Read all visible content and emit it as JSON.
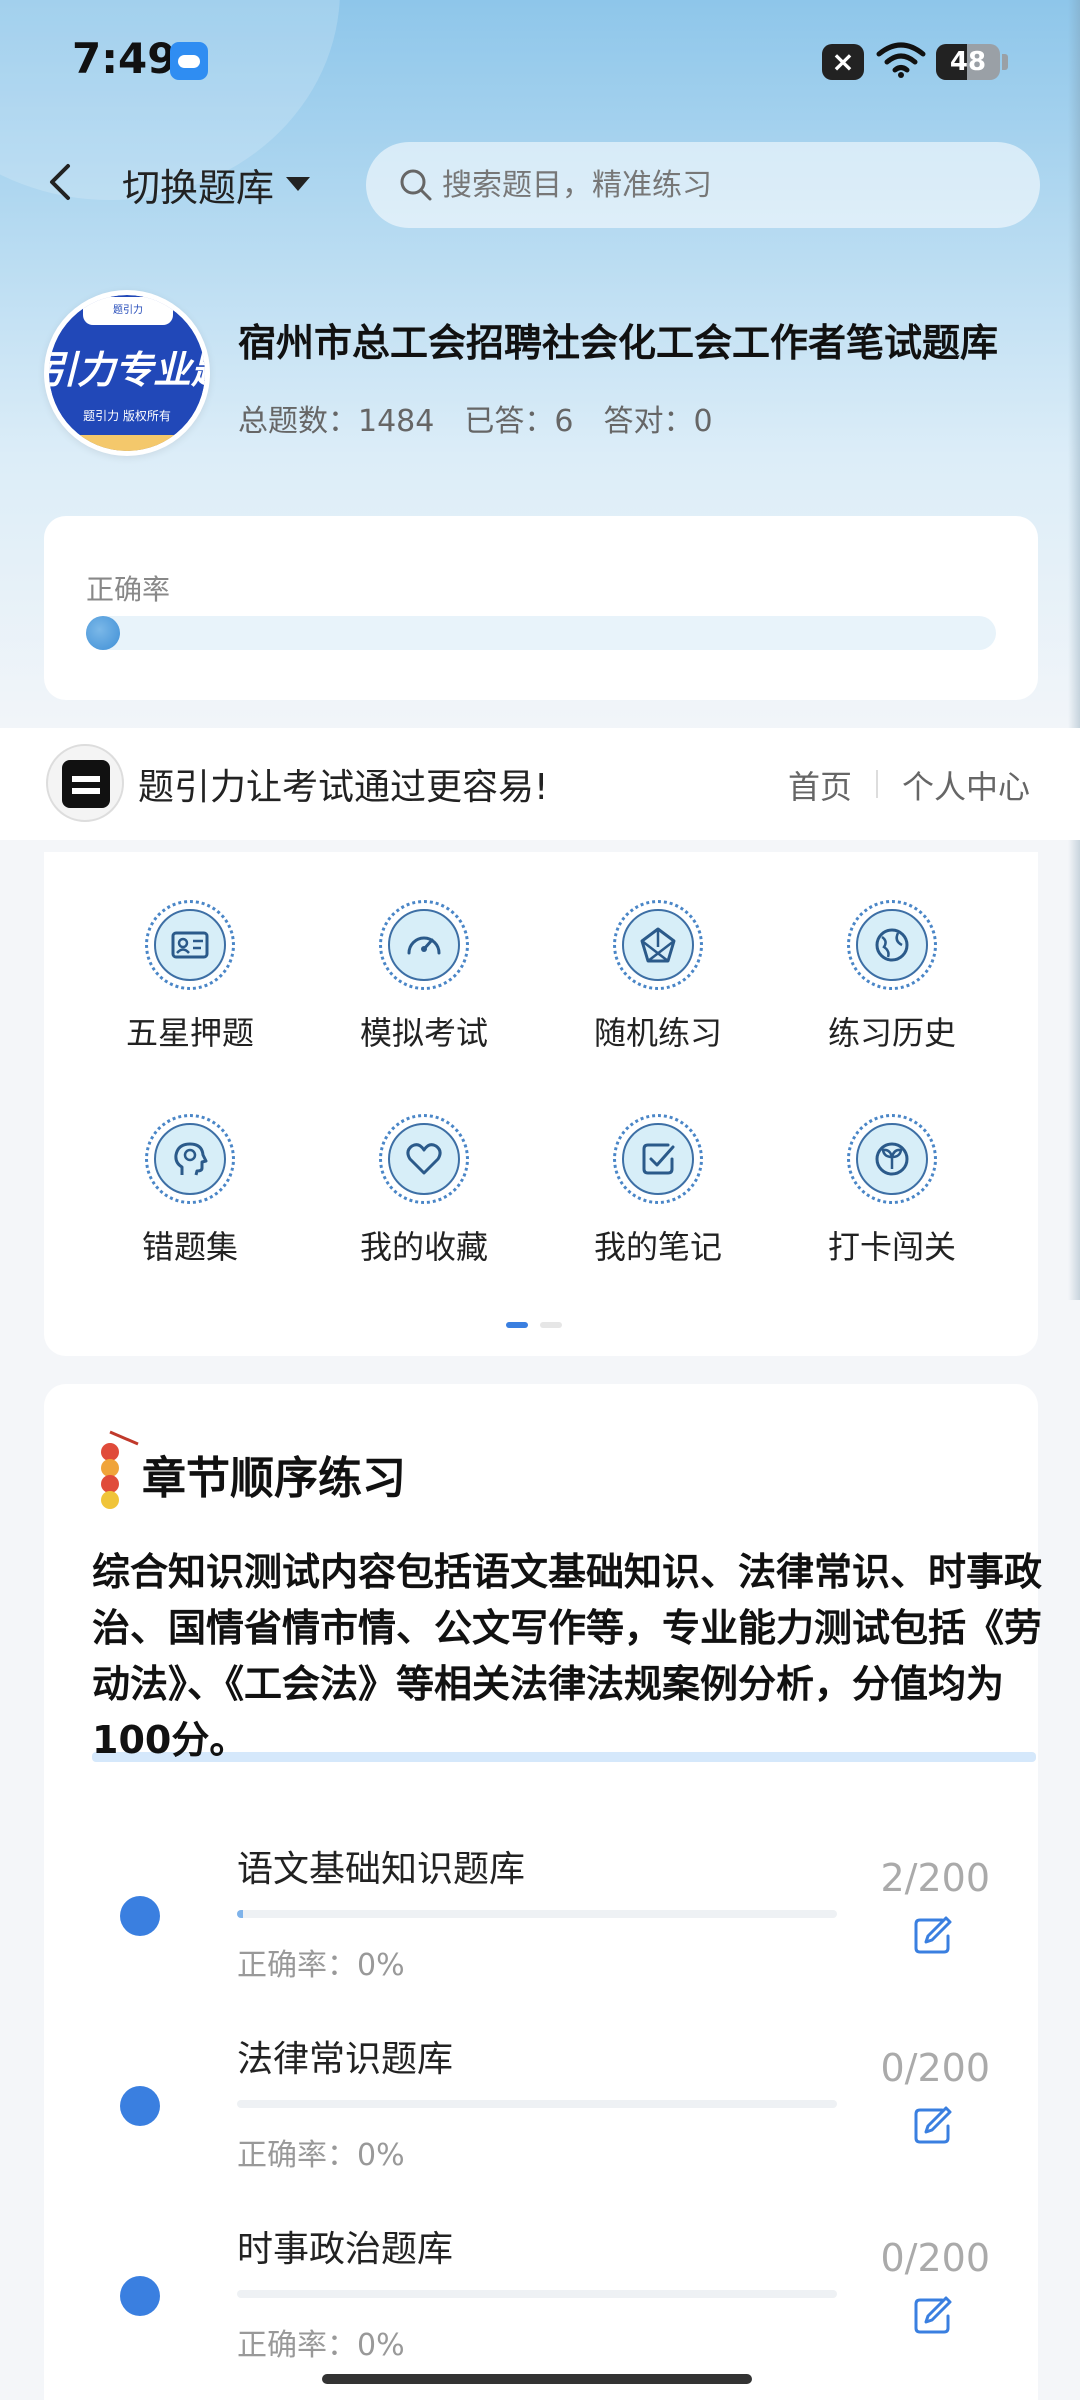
{
  "status_bar": {
    "time": "7:49",
    "battery": "48",
    "battery_level": 0.48
  },
  "header": {
    "switch_label": "切换题库",
    "search_placeholder": "搜索题目，精准练习"
  },
  "bank": {
    "logo_top": "题引力",
    "logo_text": "引力专业题",
    "logo_sub": "题引力 版权所有",
    "title": "宿州市总工会招聘社会化工会工作者笔试题库",
    "stats": [
      {
        "label": "总题数：",
        "value": "1484"
      },
      {
        "label": "已答：",
        "value": "6"
      },
      {
        "label": "答对：",
        "value": "0"
      }
    ]
  },
  "accuracy": {
    "label": "正确率",
    "value": 0
  },
  "brand": {
    "slogan": "题引力让考试通过更容易!",
    "home": "首页",
    "profile": "个人中心"
  },
  "functions": [
    {
      "label": "五星押题",
      "icon": "id-card-icon"
    },
    {
      "label": "模拟考试",
      "icon": "speedometer-icon"
    },
    {
      "label": "随机练习",
      "icon": "network-icon"
    },
    {
      "label": "练习历史",
      "icon": "globe-icon"
    },
    {
      "label": "错题集",
      "icon": "head-icon"
    },
    {
      "label": "我的收藏",
      "icon": "heart-icon"
    },
    {
      "label": "我的笔记",
      "icon": "note-check-icon"
    },
    {
      "label": "打卡闯关",
      "icon": "leaf-icon"
    }
  ],
  "chapter": {
    "title": "章节顺序练习",
    "description": "综合知识测试内容包括语文基础知识、法律常识、时事政治、国情省情市情、公文写作等，专业能力测试包括《劳动法》、《工会法》等相关法律法规案例分析，分值均为100分。",
    "items": [
      {
        "name": "语文基础知识题库",
        "accuracy": "正确率：0%",
        "progress": "2/200",
        "done": 2,
        "total": 200
      },
      {
        "name": "法律常识题库",
        "accuracy": "正确率：0%",
        "progress": "0/200",
        "done": 0,
        "total": 200
      },
      {
        "name": "时事政治题库",
        "accuracy": "正确率：0%",
        "progress": "0/200",
        "done": 0,
        "total": 200
      }
    ]
  },
  "colors": {
    "accent": "#3a7fe0",
    "hero_top": "#8ec6ea",
    "logo_blue": "#2148b8"
  }
}
